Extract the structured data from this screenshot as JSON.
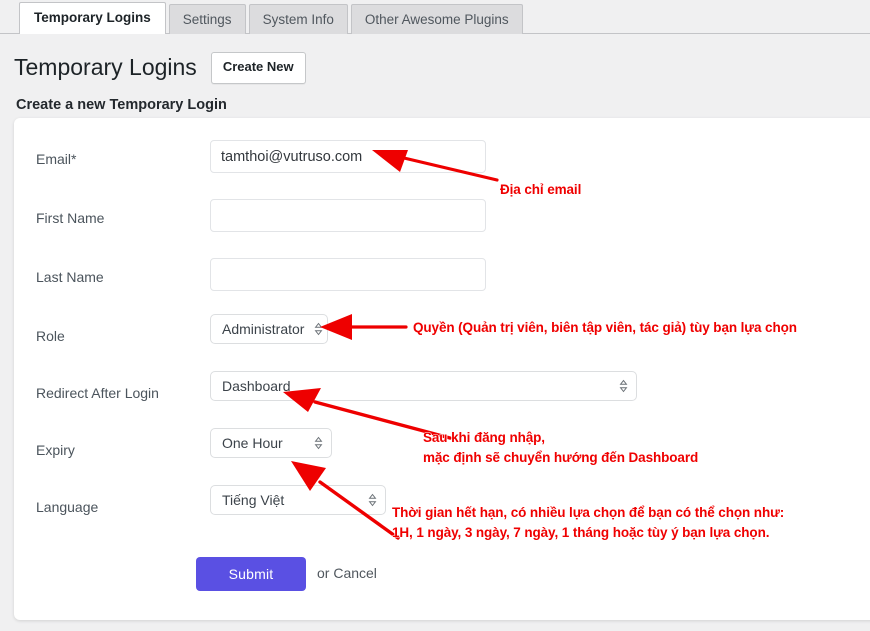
{
  "tabs": [
    {
      "label": "Temporary Logins",
      "active": true
    },
    {
      "label": "Settings",
      "active": false
    },
    {
      "label": "System Info",
      "active": false
    },
    {
      "label": "Other Awesome Plugins",
      "active": false
    }
  ],
  "header": {
    "title": "Temporary Logins",
    "create_new_label": "Create New",
    "subtitle": "Create a new Temporary Login"
  },
  "form": {
    "fields": [
      {
        "label": "Email*",
        "type": "text",
        "value": "tamthoi@vutruso.com",
        "placeholder": ""
      },
      {
        "label": "First Name",
        "type": "text",
        "value": "",
        "placeholder": ""
      },
      {
        "label": "Last Name",
        "type": "text",
        "value": "",
        "placeholder": ""
      },
      {
        "label": "Role",
        "type": "select",
        "value": "Administrator"
      },
      {
        "label": "Redirect After Login",
        "type": "select",
        "value": "Dashboard"
      },
      {
        "label": "Expiry",
        "type": "select",
        "value": "One Hour"
      },
      {
        "label": "Language",
        "type": "select",
        "value": "Tiếng Việt"
      }
    ],
    "submit_label": "Submit",
    "cancel_text": "or Cancel"
  },
  "annotations": {
    "email": "Địa chỉ email",
    "role": "Quyền (Quản trị viên, biên tập viên, tác giả) tùy bạn lựa chọn",
    "redirect": "Sau khi đăng nhập,\nmặc định sẽ chuyển hướng đến Dashboard",
    "expiry": "Thời gian hết hạn, có nhiều lựa chọn để bạn có thể chọn như:\n1H, 1 ngày, 3 ngày, 7 ngày, 1 tháng hoặc tùy ý bạn lựa chọn."
  },
  "colors": {
    "annotation_red": "#ef0000",
    "submit_purple": "#5a50e3",
    "page_bg": "#f0f0f1",
    "active_tab_bg": "#ffffff",
    "inactive_tab_bg": "#dcdcde"
  }
}
